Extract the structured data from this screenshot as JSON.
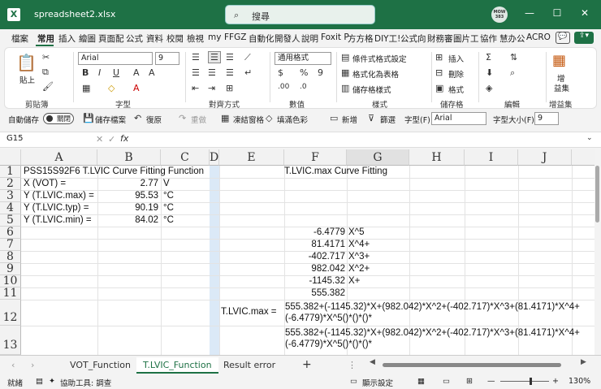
{
  "titlebar": {
    "app_logo": "X",
    "doc_title": "spreadsheet2.xlsx",
    "search_placeholder": "搜尋",
    "user_initials_top": "MOW",
    "user_initials_bottom": "383",
    "min": "—",
    "max": "☐",
    "close": "✕"
  },
  "menu": [
    "檔案",
    "常用",
    "插入",
    "繪圖",
    "頁面配",
    "公式",
    "資料",
    "校閱",
    "檢視",
    "my",
    "FFGZ",
    "自動化",
    "開發人",
    "說明",
    "Foxit P",
    "方方格",
    "DIY工!",
    "公式向",
    "財務審",
    "圖片工",
    "協作",
    "慧办公",
    "ACRO"
  ],
  "ribbon": {
    "paste_label": "貼上",
    "clipboard_label": "剪貼簿",
    "font_name": "Arial",
    "font_size": "9",
    "font_label": "字型",
    "align_label": "對齊方式",
    "number_format": "通用格式",
    "number_label": "數值",
    "styles": [
      "條件式格式設定",
      "格式化為表格",
      "儲存格樣式"
    ],
    "styles_label": "樣式",
    "cells": [
      "插入",
      "刪除",
      "格式"
    ],
    "cells_label": "儲存格",
    "editing_label": "編輯",
    "addin_top": "增",
    "addin_bottom": "益集",
    "addin_label": "增益集"
  },
  "qat": {
    "autosave": "自動儲存",
    "toggle": "關閉",
    "save": "儲存檔案",
    "undo": "復原",
    "redo": "重做",
    "freeze": "凍結窗格",
    "fill": "填滿色彩",
    "new": "新增",
    "filter": "篩選",
    "font_label": "字型(F):",
    "font_value": "Arial",
    "size_label": "字型大小(F):",
    "size_value": "9"
  },
  "formula_bar": {
    "name_box": "G15",
    "fx": "fx",
    "value": ""
  },
  "columns": [
    "A",
    "B",
    "C",
    "D",
    "E",
    "F",
    "G",
    "H",
    "I",
    "J"
  ],
  "rows": [
    "1",
    "2",
    "3",
    "4",
    "5",
    "6",
    "7",
    "8",
    "9",
    "10",
    "11",
    "12",
    "13"
  ],
  "cells": {
    "A1": "PSS15S92F6 T.LVIC Curve Fitting Function",
    "A2": "X (VOT) =",
    "B2": "2.77",
    "C2": "V",
    "A3": "Y (T.LVIC.max) =",
    "B3": "95.53",
    "C3": "°C",
    "A4": "Y (T.LVIC.typ) =",
    "B4": "90.19",
    "C4": "°C",
    "A5": "Y (T.LVIC.min) =",
    "B5": "84.02",
    "C5": "°C",
    "F1": "T.LVIC.max Curve Fitting",
    "F6": "-6.4779",
    "G6": "X^5",
    "F7": "81.4171",
    "G7": "X^4+",
    "F8": "-402.717",
    "G8": "X^3+",
    "F9": "982.042",
    "G9": "X^2+",
    "F10": "-1145.32",
    "G10": "X+",
    "F11": "555.382",
    "E12": "T.LVIC.max =",
    "F12": "555.382+(-1145.32)*X+(982.042)*X^2+(-402.717)*X^3+(81.4171)*X^4+(-6.4779)*X^5()*()*()*",
    "F13": "555.382+(-1145.32)*X+(982.042)*X^2+(-402.717)*X^3+(81.4171)*X^4+(-6.4779)*X^5()*()*()*"
  },
  "sheet_tabs": [
    "VOT_Function",
    "T.LVIC_Function",
    "Result error"
  ],
  "active_tab": "T.LVIC_Function",
  "status": {
    "mode": "就緒",
    "accessibility": "協助工具: 調查",
    "display_settings": "顯示設定",
    "zoom": "130%"
  },
  "colors": {
    "brand": "#1e7145",
    "selected_col": "#dbe9f7"
  }
}
